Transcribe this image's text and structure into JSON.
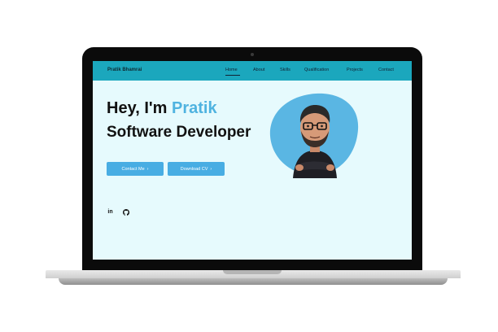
{
  "brand": "Pratik Bhamrai",
  "nav": {
    "items": [
      "Home",
      "About",
      "Skills",
      "Qualification",
      "Projects",
      "Contact"
    ],
    "active_index": 0
  },
  "hero": {
    "greeting": "Hey, I'm ",
    "name": "Pratik",
    "title": "Software Developer"
  },
  "buttons": {
    "contact": "Contact Me",
    "contact_arrow": "›",
    "cv": "Download CV",
    "cv_arrow": "›"
  },
  "social": {
    "linkedin": "in"
  },
  "colors": {
    "nav_bg": "#1ba7bd",
    "accent": "#4fb3e0",
    "button": "#48ade3",
    "page_bg": "#e6fafd",
    "blob": "#5ab6e3"
  },
  "icons": {
    "linkedin": "linkedin-icon",
    "github": "github-icon",
    "camera": "camera-dot"
  }
}
